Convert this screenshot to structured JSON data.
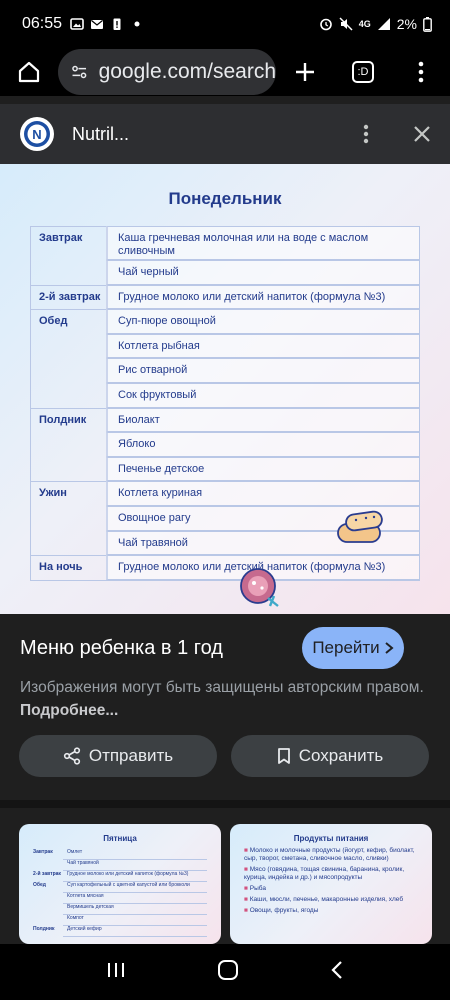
{
  "status_bar": {
    "time": "06:55",
    "network": "4G",
    "battery": "2%",
    "icons": [
      "image-icon",
      "mail-icon",
      "battery-alert-icon",
      "dot-icon",
      "alarm-icon",
      "mute-icon",
      "signal-icon"
    ]
  },
  "browser": {
    "url": "google.com/search",
    "tab_count": ":D"
  },
  "panel": {
    "site_name": "Nutril...",
    "logo_letter": "N"
  },
  "menu_image": {
    "title": "Понедельник",
    "rows": [
      {
        "meal": "Завтрак",
        "food": "Каша гречневая молочная или на воде с маслом сливочным"
      },
      {
        "meal": "",
        "food": "Чай черный"
      },
      {
        "meal": "2-й завтрак",
        "food": "Грудное молоко или детский напиток (формула №3)"
      },
      {
        "meal": "Обед",
        "food": "Суп-пюре овощной"
      },
      {
        "meal": "",
        "food": "Котлета рыбная"
      },
      {
        "meal": "",
        "food": "Рис отварной"
      },
      {
        "meal": "",
        "food": "Сок фруктовый"
      },
      {
        "meal": "Полдник",
        "food": "Биолакт"
      },
      {
        "meal": "",
        "food": "Яблоко"
      },
      {
        "meal": "",
        "food": "Печенье детское"
      },
      {
        "meal": "Ужин",
        "food": "Котлета куриная"
      },
      {
        "meal": "",
        "food": "Овощное рагу"
      },
      {
        "meal": "",
        "food": "Чай травяной"
      },
      {
        "meal": "На ночь",
        "food": "Грудное молоко или детский напиток (формула №3)"
      }
    ]
  },
  "result": {
    "title": "Меню ребенка в 1 год",
    "go_label": "Перейти",
    "copyright_text": "Изображения могут быть защищены авторским правом.",
    "more_link": "Подробнее..."
  },
  "actions": {
    "share_label": "Отправить",
    "save_label": "Сохранить"
  },
  "related": {
    "card1": {
      "title": "Пятница",
      "rows": [
        {
          "meal": "Завтрак",
          "food": "Омлет"
        },
        {
          "meal": "",
          "food": "Чай травяной"
        },
        {
          "meal": "2-й завтрак",
          "food": "Грудное молоко или детский напиток (формула №3)"
        },
        {
          "meal": "Обед",
          "food": "Суп картофельный с цветной капустой или брокколи"
        },
        {
          "meal": "",
          "food": "Котлета мясная"
        },
        {
          "meal": "",
          "food": "Вермишель детская"
        },
        {
          "meal": "",
          "food": "Компот"
        },
        {
          "meal": "Полдник",
          "food": "Детский кефир"
        }
      ]
    },
    "card2": {
      "title": "Продукты питания",
      "bullets": [
        "Молоко и молочные продукты (йогурт, кефир, биолакт, сыр, творог, сметана, сливочное масло, сливки)",
        "Мясо (говядина, тощая свинина, баранина, кролик, курица, индейка и др.) и мясопродукты",
        "Рыба",
        "Каши, мюсли, печенье, макаронные изделия, хлеб",
        "Овощи, фрукты, ягоды"
      ]
    }
  },
  "colors": {
    "accent": "#8ab4f8",
    "menu_text": "#233b8c",
    "background": "#1f1f1f"
  }
}
